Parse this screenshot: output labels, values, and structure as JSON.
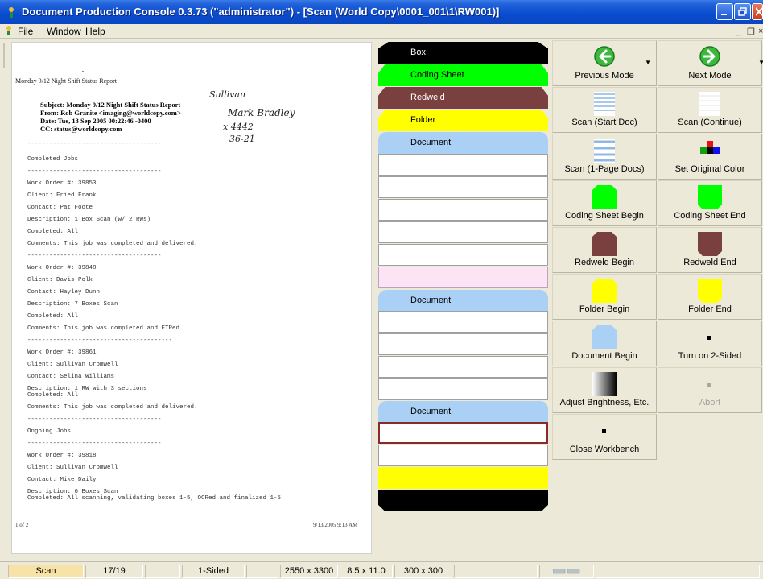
{
  "window": {
    "title": "Document Production Console 0.3.73 (\"administrator\") - [Scan (World Copy\\0001_001\\1\\RW001)]"
  },
  "menu": {
    "items": [
      "File",
      "Window",
      "Help"
    ],
    "mdi_controls": [
      "_",
      "❐",
      "×"
    ]
  },
  "preview": {
    "header": "Monday 9/12 Night Shift Status Report",
    "subject": "Subject: Monday 9/12 Night Shift Status Report",
    "from": "From: Rob Granite <imaging@worldcopy.com>",
    "date": "Date: Tue, 13 Sep 2005 00:22:46 -0400",
    "cc": "CC: status@worldcopy.com",
    "handwriting": [
      "Sullivan",
      "Mark Bradley",
      "x 4442",
      "36-21"
    ],
    "lines": [
      "-------------------------------------",
      "Completed Jobs",
      "-------------------------------------",
      "Work Order #: 39853",
      "Client: Fried Frank",
      "Contact: Pat Foote",
      "Description: 1 Box Scan (w/ 2 RWs)",
      "Completed: All",
      "Comments: This job was completed and delivered.",
      "-------------------------------------",
      "Work Order #: 39848",
      "Client: Davis Polk",
      "Contact: Hayley Dunn",
      "Description: 7 Boxes Scan",
      "Completed: All",
      "Comments: This job was completed and FTPed.",
      "----------------------------------------",
      "Work Order #: 39861",
      "Client: Sullivan Cromwell",
      "Contact: Selina Williams",
      "Description: 1 RW with 3 sections",
      "Completed: All",
      "Comments: This job was completed and delivered.",
      "-------------------------------------",
      "Ongoing Jobs",
      "-------------------------------------",
      "Work Order #: 39818",
      "Client: Sullivan Cromwell",
      "Contact: Mike Daily",
      "Description: 6 Boxes Scan",
      "Completed: All scanning, validating boxes 1-5, OCRed and finalized 1-5"
    ],
    "footer_left": "1 of 2",
    "footer_right": "9/13/2005 9:13 AM"
  },
  "tree": {
    "labels": {
      "box": "Box",
      "coding_sheet": "Coding Sheet",
      "redweld": "Redweld",
      "folder": "Folder",
      "document": "Document"
    },
    "colors": {
      "box": "#000000",
      "coding_sheet": "#00ff00",
      "redweld": "#7a3f3f",
      "folder": "#ffff00",
      "document": "#aad0f5",
      "pink": "#fce4f5",
      "selected_border": "#8b2a2a"
    }
  },
  "buttons": {
    "previous_mode": "Previous Mode",
    "next_mode": "Next Mode",
    "scan_start_doc": "Scan (Start Doc)",
    "scan_continue": "Scan (Continue)",
    "scan_1page": "Scan (1-Page Docs)",
    "set_original_color": "Set Original Color",
    "coding_sheet_begin": "Coding Sheet Begin",
    "coding_sheet_end": "Coding Sheet End",
    "redweld_begin": "Redweld Begin",
    "redweld_end": "Redweld End",
    "folder_begin": "Folder Begin",
    "folder_end": "Folder End",
    "document_begin": "Document Begin",
    "turn_on_2sided": "Turn on 2-Sided",
    "adjust_brightness": "Adjust Brightness, Etc.",
    "abort": "Abort",
    "close_workbench": "Close Workbench"
  },
  "status": {
    "mode": "Scan",
    "count": "17/19",
    "sides": "1-Sided",
    "pixels": "2550 x 3300",
    "inches": "8.5 x 11.0",
    "dpi": "300 x 300"
  }
}
